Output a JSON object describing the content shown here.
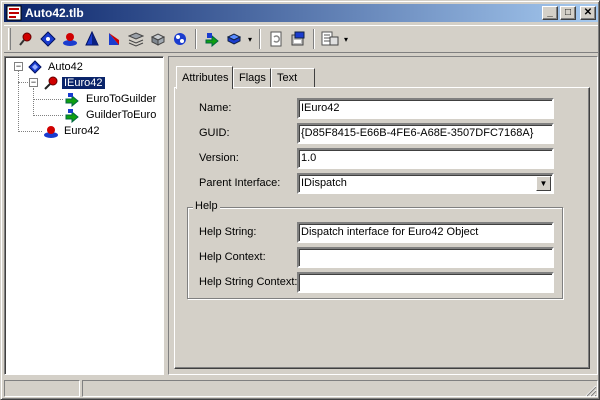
{
  "window": {
    "title": "Auto42.tlb",
    "minimize_label": "_",
    "maximize_label": "□",
    "close_label": "✕"
  },
  "toolbar": {
    "buttons": [
      {
        "icon": "pin-red-icon"
      },
      {
        "icon": "diamond-blue-icon"
      },
      {
        "icon": "coclass-red-icon"
      },
      {
        "icon": "pyramid-blue-icon"
      },
      {
        "icon": "sail-blue-icon"
      },
      {
        "icon": "stack-gray-icon"
      },
      {
        "icon": "module-gray-icon"
      },
      {
        "icon": "typedef-blue-icon"
      },
      {
        "icon": "green-arrow-method-icon"
      },
      {
        "icon": "property-blue-icon"
      },
      {
        "icon": "refresh-doc-icon"
      },
      {
        "icon": "register-icon"
      },
      {
        "icon": "export-view-icon"
      }
    ],
    "dropdown_glyph": "▾"
  },
  "tree": {
    "expanded_glyph": "−",
    "nodes": [
      {
        "label": "Auto42",
        "icon": "library-icon"
      },
      {
        "label": "IEuro42",
        "icon": "interface-pin-icon",
        "selected": true
      },
      {
        "label": "EuroToGuilder",
        "icon": "method-icon"
      },
      {
        "label": "GuilderToEuro",
        "icon": "method-icon"
      },
      {
        "label": "Euro42",
        "icon": "coclass-icon"
      }
    ]
  },
  "tabs": [
    {
      "label": "Attributes",
      "active": true
    },
    {
      "label": "Flags",
      "active": false
    },
    {
      "label": "Text",
      "active": false
    }
  ],
  "attributes": {
    "name_label": "Name:",
    "name_value": "IEuro42",
    "guid_label": "GUID:",
    "guid_value": "{D85F8415-E66B-4FE6-A68E-3507DFC7168A}",
    "version_label": "Version:",
    "version_value": "1.0",
    "parent_label": "Parent Interface:",
    "parent_value": "IDispatch",
    "combo_arrow": "▼"
  },
  "help": {
    "group_title": "Help",
    "help_string_label": "Help String:",
    "help_string_value": "Dispatch interface for Euro42 Object",
    "help_context_label": "Help Context:",
    "help_context_value": "",
    "help_string_context_label": "Help String Context:",
    "help_string_context_value": ""
  },
  "colors": {
    "titlebar_start": "#0a246a",
    "titlebar_end": "#a6caf0",
    "face": "#d4d0c8",
    "selection": "#0a246a"
  }
}
